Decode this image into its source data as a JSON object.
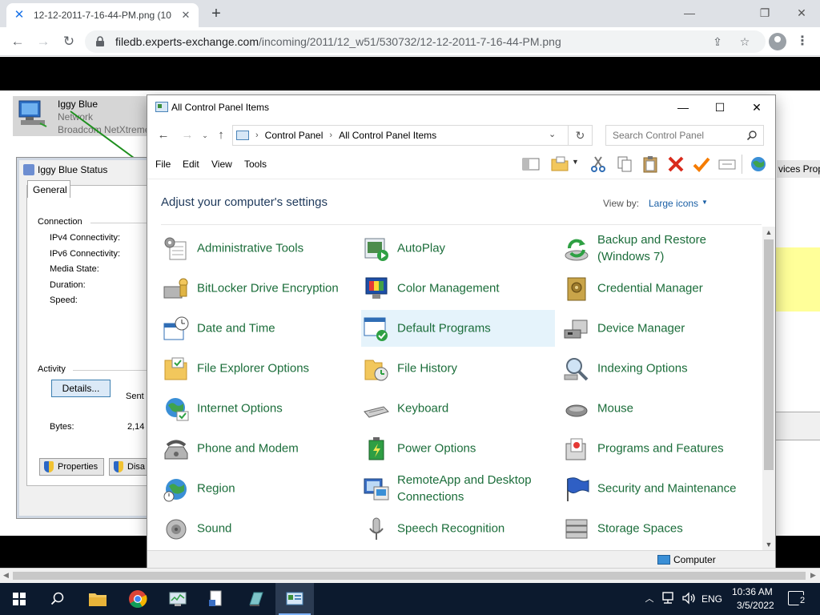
{
  "browser": {
    "tab_title": "12-12-2011-7-16-44-PM.png (10",
    "new_tab": "+",
    "url_host": "filedb.experts-exchange.com",
    "url_path": "/incoming/2011/12_w51/530732/12-12-2011-7-16-44-PM.png"
  },
  "background": {
    "network_item": {
      "name": "Iggy Blue",
      "type": "Network",
      "adapter": "Broadcom NetXtreme"
    },
    "status_window": {
      "title": "Iggy Blue Status",
      "tab": "General",
      "connection_label": "Connection",
      "ipv4": "IPv4 Connectivity:",
      "ipv6": "IPv6 Connectivity:",
      "media_state": "Media State:",
      "duration": "Duration:",
      "speed": "Speed:",
      "details_button": "Details...",
      "activity_label": "Activity",
      "sent": "Sent",
      "bytes_label": "Bytes:",
      "bytes_value": "2,14",
      "properties_button": "Properties",
      "disable_button": "Disa"
    },
    "right_window_title": "vices Prope"
  },
  "control_panel": {
    "title": "All Control Panel Items",
    "breadcrumb": [
      "Control Panel",
      "All Control Panel Items"
    ],
    "search_placeholder": "Search Control Panel",
    "menu": [
      "File",
      "Edit",
      "View",
      "Tools"
    ],
    "heading": "Adjust your computer's settings",
    "view_by_label": "View by:",
    "view_by_value": "Large icons",
    "items": [
      {
        "label": "Administrative Tools",
        "icon": "admin-tools-icon"
      },
      {
        "label": "AutoPlay",
        "icon": "autoplay-icon"
      },
      {
        "label": "Backup and Restore (Windows 7)",
        "icon": "backup-restore-icon"
      },
      {
        "label": "BitLocker Drive Encryption",
        "icon": "bitlocker-icon"
      },
      {
        "label": "Color Management",
        "icon": "color-management-icon"
      },
      {
        "label": "Credential Manager",
        "icon": "credential-manager-icon"
      },
      {
        "label": "Date and Time",
        "icon": "date-time-icon"
      },
      {
        "label": "Default Programs",
        "icon": "default-programs-icon"
      },
      {
        "label": "Device Manager",
        "icon": "device-manager-icon"
      },
      {
        "label": "File Explorer Options",
        "icon": "file-explorer-options-icon"
      },
      {
        "label": "File History",
        "icon": "file-history-icon"
      },
      {
        "label": "Indexing Options",
        "icon": "indexing-options-icon"
      },
      {
        "label": "Internet Options",
        "icon": "internet-options-icon"
      },
      {
        "label": "Keyboard",
        "icon": "keyboard-icon"
      },
      {
        "label": "Mouse",
        "icon": "mouse-icon"
      },
      {
        "label": "Phone and Modem",
        "icon": "phone-modem-icon"
      },
      {
        "label": "Power Options",
        "icon": "power-options-icon"
      },
      {
        "label": "Programs and Features",
        "icon": "programs-features-icon"
      },
      {
        "label": "Region",
        "icon": "region-icon"
      },
      {
        "label": "RemoteApp and Desktop Connections",
        "icon": "remoteapp-icon"
      },
      {
        "label": "Security and Maintenance",
        "icon": "security-maintenance-icon"
      },
      {
        "label": "Sound",
        "icon": "sound-icon"
      },
      {
        "label": "Speech Recognition",
        "icon": "speech-recognition-icon"
      },
      {
        "label": "Storage Spaces",
        "icon": "storage-spaces-icon"
      }
    ],
    "statusbar": "Computer"
  },
  "taskbar": {
    "language": "ENG",
    "time": "10:36 AM",
    "date": "3/5/2022",
    "notifications": "2"
  },
  "colors": {
    "item_label": "#1b6d3a",
    "heading": "#1e395b",
    "link": "#1a5fa5",
    "selected_item": "#e5f3fb",
    "taskbar": "#0c1a2e",
    "close_red": "#d92b1c",
    "check_orange": "#f57c00"
  }
}
